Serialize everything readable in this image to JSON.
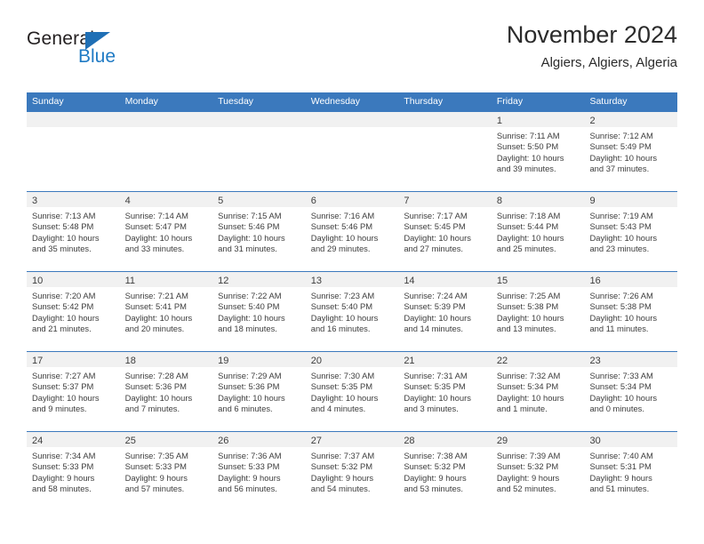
{
  "brand": {
    "name_top": "General",
    "name_bottom": "Blue",
    "accent_color": "#1f7ac4",
    "header_blue": "#3b79bd"
  },
  "header": {
    "title": "November 2024",
    "subtitle": "Algiers, Algiers, Algeria"
  },
  "weekdays": [
    "Sunday",
    "Monday",
    "Tuesday",
    "Wednesday",
    "Thursday",
    "Friday",
    "Saturday"
  ],
  "weeks": [
    [
      {
        "day": ""
      },
      {
        "day": ""
      },
      {
        "day": ""
      },
      {
        "day": ""
      },
      {
        "day": ""
      },
      {
        "day": "1",
        "sunrise": "Sunrise: 7:11 AM",
        "sunset": "Sunset: 5:50 PM",
        "daylight_1": "Daylight: 10 hours",
        "daylight_2": "and 39 minutes."
      },
      {
        "day": "2",
        "sunrise": "Sunrise: 7:12 AM",
        "sunset": "Sunset: 5:49 PM",
        "daylight_1": "Daylight: 10 hours",
        "daylight_2": "and 37 minutes."
      }
    ],
    [
      {
        "day": "3",
        "sunrise": "Sunrise: 7:13 AM",
        "sunset": "Sunset: 5:48 PM",
        "daylight_1": "Daylight: 10 hours",
        "daylight_2": "and 35 minutes."
      },
      {
        "day": "4",
        "sunrise": "Sunrise: 7:14 AM",
        "sunset": "Sunset: 5:47 PM",
        "daylight_1": "Daylight: 10 hours",
        "daylight_2": "and 33 minutes."
      },
      {
        "day": "5",
        "sunrise": "Sunrise: 7:15 AM",
        "sunset": "Sunset: 5:46 PM",
        "daylight_1": "Daylight: 10 hours",
        "daylight_2": "and 31 minutes."
      },
      {
        "day": "6",
        "sunrise": "Sunrise: 7:16 AM",
        "sunset": "Sunset: 5:46 PM",
        "daylight_1": "Daylight: 10 hours",
        "daylight_2": "and 29 minutes."
      },
      {
        "day": "7",
        "sunrise": "Sunrise: 7:17 AM",
        "sunset": "Sunset: 5:45 PM",
        "daylight_1": "Daylight: 10 hours",
        "daylight_2": "and 27 minutes."
      },
      {
        "day": "8",
        "sunrise": "Sunrise: 7:18 AM",
        "sunset": "Sunset: 5:44 PM",
        "daylight_1": "Daylight: 10 hours",
        "daylight_2": "and 25 minutes."
      },
      {
        "day": "9",
        "sunrise": "Sunrise: 7:19 AM",
        "sunset": "Sunset: 5:43 PM",
        "daylight_1": "Daylight: 10 hours",
        "daylight_2": "and 23 minutes."
      }
    ],
    [
      {
        "day": "10",
        "sunrise": "Sunrise: 7:20 AM",
        "sunset": "Sunset: 5:42 PM",
        "daylight_1": "Daylight: 10 hours",
        "daylight_2": "and 21 minutes."
      },
      {
        "day": "11",
        "sunrise": "Sunrise: 7:21 AM",
        "sunset": "Sunset: 5:41 PM",
        "daylight_1": "Daylight: 10 hours",
        "daylight_2": "and 20 minutes."
      },
      {
        "day": "12",
        "sunrise": "Sunrise: 7:22 AM",
        "sunset": "Sunset: 5:40 PM",
        "daylight_1": "Daylight: 10 hours",
        "daylight_2": "and 18 minutes."
      },
      {
        "day": "13",
        "sunrise": "Sunrise: 7:23 AM",
        "sunset": "Sunset: 5:40 PM",
        "daylight_1": "Daylight: 10 hours",
        "daylight_2": "and 16 minutes."
      },
      {
        "day": "14",
        "sunrise": "Sunrise: 7:24 AM",
        "sunset": "Sunset: 5:39 PM",
        "daylight_1": "Daylight: 10 hours",
        "daylight_2": "and 14 minutes."
      },
      {
        "day": "15",
        "sunrise": "Sunrise: 7:25 AM",
        "sunset": "Sunset: 5:38 PM",
        "daylight_1": "Daylight: 10 hours",
        "daylight_2": "and 13 minutes."
      },
      {
        "day": "16",
        "sunrise": "Sunrise: 7:26 AM",
        "sunset": "Sunset: 5:38 PM",
        "daylight_1": "Daylight: 10 hours",
        "daylight_2": "and 11 minutes."
      }
    ],
    [
      {
        "day": "17",
        "sunrise": "Sunrise: 7:27 AM",
        "sunset": "Sunset: 5:37 PM",
        "daylight_1": "Daylight: 10 hours",
        "daylight_2": "and 9 minutes."
      },
      {
        "day": "18",
        "sunrise": "Sunrise: 7:28 AM",
        "sunset": "Sunset: 5:36 PM",
        "daylight_1": "Daylight: 10 hours",
        "daylight_2": "and 7 minutes."
      },
      {
        "day": "19",
        "sunrise": "Sunrise: 7:29 AM",
        "sunset": "Sunset: 5:36 PM",
        "daylight_1": "Daylight: 10 hours",
        "daylight_2": "and 6 minutes."
      },
      {
        "day": "20",
        "sunrise": "Sunrise: 7:30 AM",
        "sunset": "Sunset: 5:35 PM",
        "daylight_1": "Daylight: 10 hours",
        "daylight_2": "and 4 minutes."
      },
      {
        "day": "21",
        "sunrise": "Sunrise: 7:31 AM",
        "sunset": "Sunset: 5:35 PM",
        "daylight_1": "Daylight: 10 hours",
        "daylight_2": "and 3 minutes."
      },
      {
        "day": "22",
        "sunrise": "Sunrise: 7:32 AM",
        "sunset": "Sunset: 5:34 PM",
        "daylight_1": "Daylight: 10 hours",
        "daylight_2": "and 1 minute."
      },
      {
        "day": "23",
        "sunrise": "Sunrise: 7:33 AM",
        "sunset": "Sunset: 5:34 PM",
        "daylight_1": "Daylight: 10 hours",
        "daylight_2": "and 0 minutes."
      }
    ],
    [
      {
        "day": "24",
        "sunrise": "Sunrise: 7:34 AM",
        "sunset": "Sunset: 5:33 PM",
        "daylight_1": "Daylight: 9 hours",
        "daylight_2": "and 58 minutes."
      },
      {
        "day": "25",
        "sunrise": "Sunrise: 7:35 AM",
        "sunset": "Sunset: 5:33 PM",
        "daylight_1": "Daylight: 9 hours",
        "daylight_2": "and 57 minutes."
      },
      {
        "day": "26",
        "sunrise": "Sunrise: 7:36 AM",
        "sunset": "Sunset: 5:33 PM",
        "daylight_1": "Daylight: 9 hours",
        "daylight_2": "and 56 minutes."
      },
      {
        "day": "27",
        "sunrise": "Sunrise: 7:37 AM",
        "sunset": "Sunset: 5:32 PM",
        "daylight_1": "Daylight: 9 hours",
        "daylight_2": "and 54 minutes."
      },
      {
        "day": "28",
        "sunrise": "Sunrise: 7:38 AM",
        "sunset": "Sunset: 5:32 PM",
        "daylight_1": "Daylight: 9 hours",
        "daylight_2": "and 53 minutes."
      },
      {
        "day": "29",
        "sunrise": "Sunrise: 7:39 AM",
        "sunset": "Sunset: 5:32 PM",
        "daylight_1": "Daylight: 9 hours",
        "daylight_2": "and 52 minutes."
      },
      {
        "day": "30",
        "sunrise": "Sunrise: 7:40 AM",
        "sunset": "Sunset: 5:31 PM",
        "daylight_1": "Daylight: 9 hours",
        "daylight_2": "and 51 minutes."
      }
    ]
  ]
}
